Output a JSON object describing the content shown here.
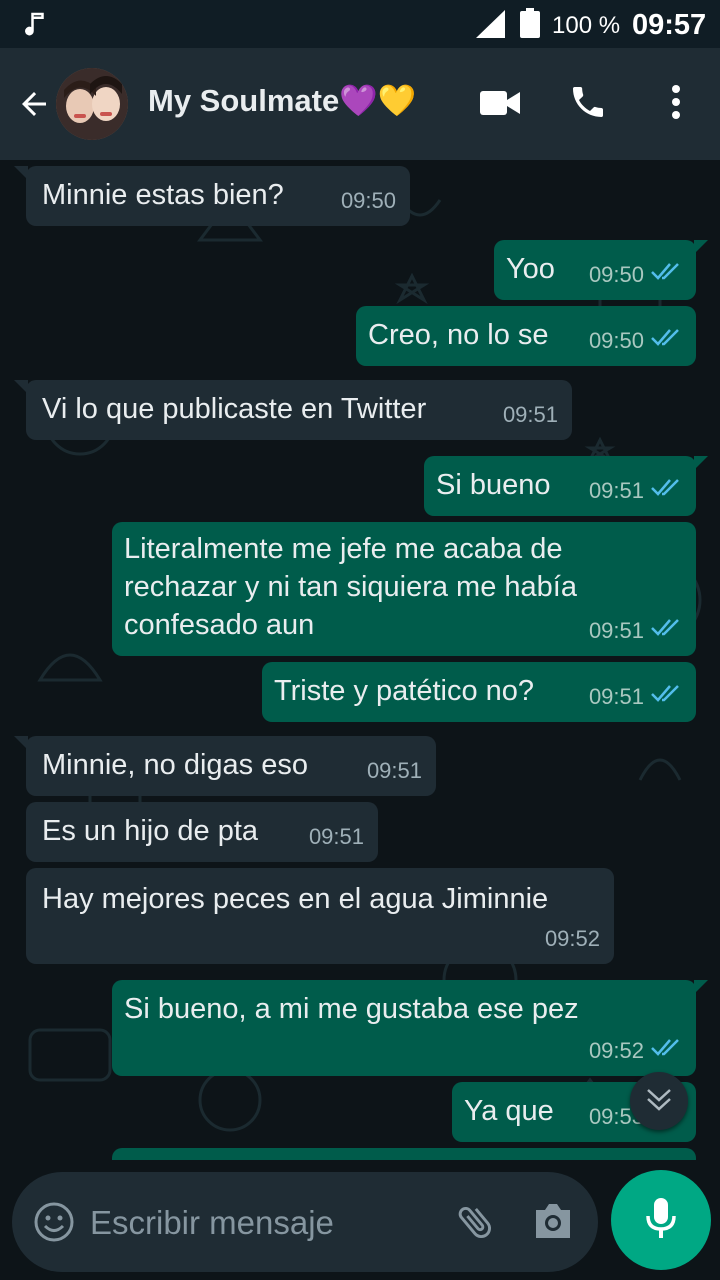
{
  "status_bar": {
    "battery_text": "100 %",
    "time": "09:57",
    "icons": [
      "music-note-icon",
      "cell-signal-icon",
      "battery-icon"
    ]
  },
  "header": {
    "contact_name": "My Soulmate💜💛",
    "icons": [
      "back-arrow-icon",
      "video-call-icon",
      "phone-icon",
      "more-vert-icon"
    ]
  },
  "messages": [
    {
      "dir": "in",
      "text": "Minnie estas bien?",
      "time": "09:50"
    },
    {
      "dir": "out",
      "text": "Yoo",
      "time": "09:50",
      "status": "read"
    },
    {
      "dir": "out",
      "text": "Creo, no lo se",
      "time": "09:50",
      "status": "read"
    },
    {
      "dir": "in",
      "text": "Vi lo que publicaste en Twitter",
      "time": "09:51"
    },
    {
      "dir": "out",
      "text": "Si bueno",
      "time": "09:51",
      "status": "read"
    },
    {
      "dir": "out",
      "text": "Literalmente me jefe me acaba de\nrechazar y ni tan siquiera me había\nconfesado aun",
      "time": "09:51",
      "status": "read"
    },
    {
      "dir": "out",
      "text": "Triste y patético no?",
      "time": "09:51",
      "status": "read"
    },
    {
      "dir": "in",
      "text": "Minnie, no digas eso",
      "time": "09:51"
    },
    {
      "dir": "in",
      "text": "Es un hijo de pta",
      "time": "09:51"
    },
    {
      "dir": "in",
      "text": "Hay mejores peces en el agua Jiminnie",
      "time": "09:52"
    },
    {
      "dir": "out",
      "text": "Si bueno, a mi me gustaba ese pez",
      "time": "09:52",
      "status": "read"
    },
    {
      "dir": "out",
      "text": "Ya que",
      "time": "09:53",
      "status": "read"
    }
  ],
  "composer": {
    "placeholder": "Escribir mensaje",
    "icons": [
      "emoji-icon",
      "attach-icon",
      "camera-icon",
      "microphone-icon"
    ]
  },
  "colors": {
    "incoming_bubble": "#1f2c34",
    "outgoing_bubble": "#005c4b",
    "read_tick": "#53bdeb",
    "accent": "#00a884"
  }
}
